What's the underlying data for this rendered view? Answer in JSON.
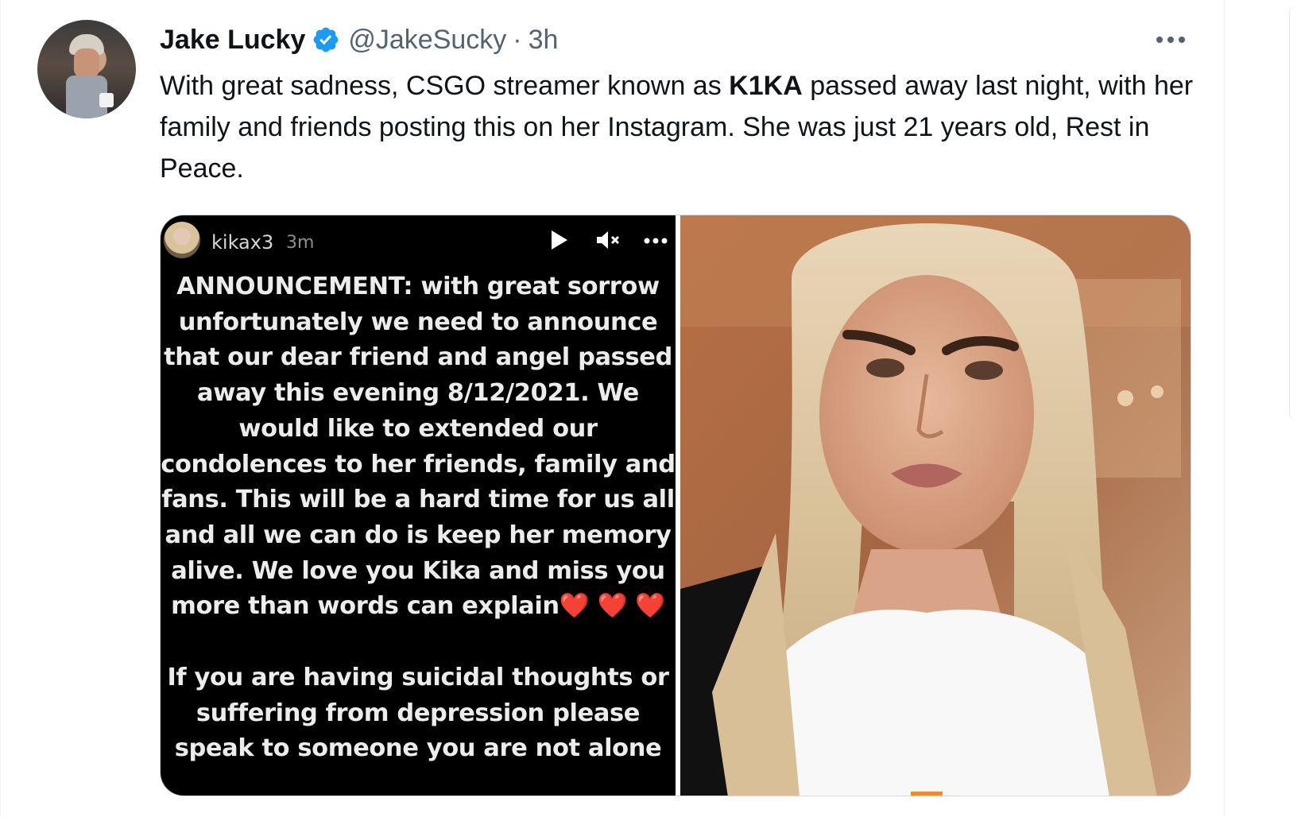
{
  "tweet": {
    "display_name": "Jake Lucky",
    "handle": "@JakeSucky",
    "separator": "·",
    "time": "3h",
    "text_before_bold": "With great sadness, CSGO streamer known as ",
    "text_bold": "K1KA",
    "text_after_bold": " passed away last night, with her family and friends posting this on her Instagram. She was just 21 years old, Rest in Peace."
  },
  "story": {
    "username": "kikax3",
    "time": "3m",
    "message": "ANNOUNCEMENT: with great sorrow\nunfortunately we need to announce\nthat our dear friend and angel passed\naway this evening 8/12/2021. We\nwould like to extended our\ncondolences to her friends, family and\nfans. This will be a hard time for us all\nand all we can do is keep her memory\nalive. We love you Kika and miss you\nmore than words can explain",
    "hearts": "❤️ ❤️ ❤️",
    "help": "If you are having suicidal thoughts or\nsuffering from depression please\nspeak to someone you are not alone"
  },
  "icons": {
    "verified": "verified-badge-icon",
    "more": "more-horizontal-icon",
    "play": "play-icon",
    "mute": "mute-icon"
  },
  "colors": {
    "verified_blue": "#1d9bf0",
    "text_primary": "#0f1419",
    "text_secondary": "#536471",
    "heart_red": "#e0282e"
  }
}
